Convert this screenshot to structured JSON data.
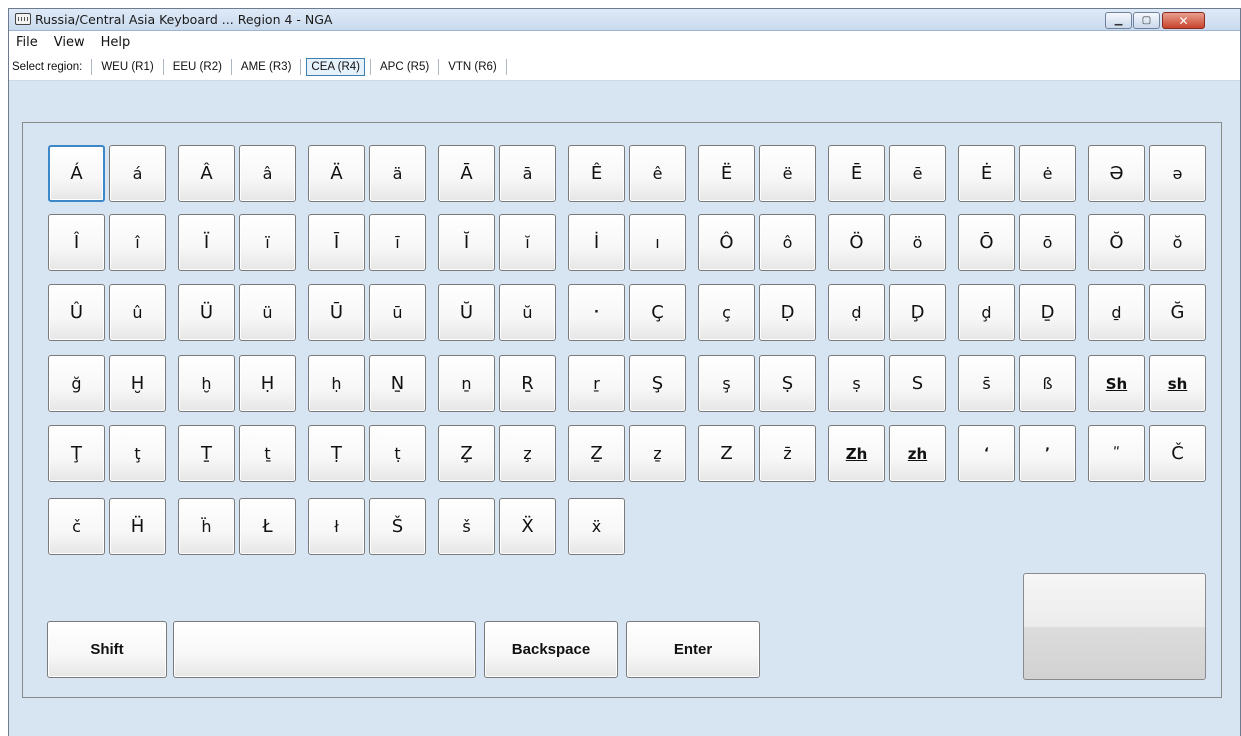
{
  "window": {
    "title": "Russia/Central Asia Keyboard ... Region 4 - NGA"
  },
  "menu": {
    "items": [
      "File",
      "View",
      "Help"
    ]
  },
  "regions": {
    "label": "Select region:",
    "items": [
      "WEU (R1)",
      "EEU (R2)",
      "AME (R3)",
      "CEA (R4)",
      "APC (R5)",
      "VTN (R6)"
    ],
    "selected": "CEA (R4)"
  },
  "keyboard": {
    "rows": [
      [
        "Á",
        "á",
        "Â",
        "â",
        "Ä",
        "ä",
        "Ā",
        "ā",
        "Ê",
        "ê",
        "Ë",
        "ë",
        "Ē",
        "ē",
        "Ė",
        "ė",
        "Ə",
        "ə"
      ],
      [
        "Î",
        "î",
        "Ï",
        "ï",
        "Ī",
        "ī",
        "Ĭ",
        "ĭ",
        "İ",
        "ı",
        "Ô",
        "ô",
        "Ö",
        "ö",
        "Ō",
        "ō",
        "Ŏ",
        "ŏ"
      ],
      [
        "Û",
        "û",
        "Ü",
        "ü",
        "Ū",
        "ū",
        "Ŭ",
        "ŭ",
        "·",
        "Ç",
        "ç",
        "Ḍ",
        "ḍ",
        "Ḑ",
        "ḑ",
        "Ḏ",
        "ḏ",
        "Ğ"
      ],
      [
        "ğ",
        "Ḫ",
        "ḫ",
        "Ḥ",
        "ḥ",
        "Ṉ",
        "ṉ",
        "Ṟ",
        "ṟ",
        "Ş",
        "ş",
        "Ṣ",
        "ṣ",
        "S",
        "s̄",
        "ß",
        "Sh",
        "sh"
      ],
      [
        "Ţ",
        "ţ",
        "Ṯ",
        "ṯ",
        "Ṭ",
        "ṭ",
        "Z̧",
        "z̧",
        "Ẕ",
        "ẕ",
        "Z",
        "z̄",
        "Zh",
        "zh",
        "ʻ",
        "ʼ",
        "ʺ",
        "Č"
      ],
      [
        "č",
        "Ḧ",
        "ḧ",
        "Ł",
        "ł",
        "Š",
        "š",
        "Ẍ",
        "ẍ"
      ]
    ],
    "shift_label": "Shift",
    "text_value": "",
    "backspace_label": "Backspace",
    "enter_label": "Enter"
  }
}
